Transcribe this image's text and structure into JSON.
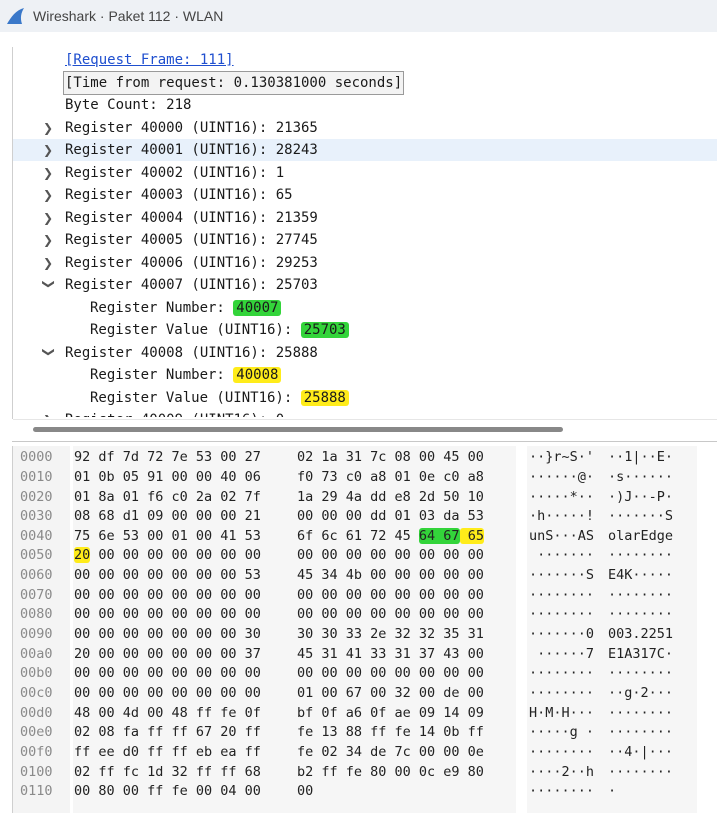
{
  "window": {
    "title": "Wireshark · Paket 112 · WLAN"
  },
  "details": {
    "request_frame": "[Request Frame: 111]",
    "time_from_request": "[Time from request: 0.130381000 seconds]",
    "byte_count": "Byte Count: 218",
    "registers": [
      "Register 40000 (UINT16): 21365",
      "Register 40001 (UINT16): 28243",
      "Register 40002 (UINT16): 1",
      "Register 40003 (UINT16): 65",
      "Register 40004 (UINT16): 21359",
      "Register 40005 (UINT16): 27745",
      "Register 40006 (UINT16): 29253",
      "Register 40007 (UINT16): 25703"
    ],
    "reg40007": {
      "number_label": "Register Number: ",
      "number_value": "40007",
      "value_label": "Register Value (UINT16): ",
      "value_value": "25703"
    },
    "reg40008_header": "Register 40008 (UINT16): 25888",
    "reg40008": {
      "number_label": "Register Number: ",
      "number_value": "40008",
      "value_label": "Register Value (UINT16): ",
      "value_value": "25888"
    },
    "reg40009_partial": "Register 40009 (UINT16): 0"
  },
  "hex": {
    "rows": [
      {
        "off": "0000",
        "b1": "92 df 7d 72 7e 53 00 27",
        "b2": "02 1a 31 7c 08 00 45 00",
        "a1": "··}r~S·'",
        "a2": "··1|··E·"
      },
      {
        "off": "0010",
        "b1": "01 0b 05 91 00 00 40 06",
        "b2": "f0 73 c0 a8 01 0e c0 a8",
        "a1": "······@·",
        "a2": "·s······"
      },
      {
        "off": "0020",
        "b1": "01 8a 01 f6 c0 2a 02 7f",
        "b2": "1a 29 4a dd e8 2d 50 10",
        "a1": "·····*··",
        "a2": "·)J··-P·"
      },
      {
        "off": "0030",
        "b1": "08 68 d1 09 00 00 00 21",
        "b2": "00 00 00 dd 01 03 da 53",
        "a1": "·h·····!",
        "a2": "·······S"
      },
      {
        "off": "0040",
        "b1": "75 6e 53 00 01 00 41 53",
        "b2": "6f 6c 61 72 45 ",
        "b2g": "64 67",
        "b2y": " 65",
        "a1": "unS···AS",
        "a2": "olarEdge"
      },
      {
        "off": "0050",
        "b1y": "20",
        "b1": " 00 00 00 00 00 00 00",
        "b2": "00 00 00 00 00 00 00 00",
        "a1": " ·······",
        "a2": "········"
      },
      {
        "off": "0060",
        "b1": "00 00 00 00 00 00 00 53",
        "b2": "45 34 4b 00 00 00 00 00",
        "a1": "·······S",
        "a2": "E4K·····"
      },
      {
        "off": "0070",
        "b1": "00 00 00 00 00 00 00 00",
        "b2": "00 00 00 00 00 00 00 00",
        "a1": "········",
        "a2": "········"
      },
      {
        "off": "0080",
        "b1": "00 00 00 00 00 00 00 00",
        "b2": "00 00 00 00 00 00 00 00",
        "a1": "········",
        "a2": "········"
      },
      {
        "off": "0090",
        "b1": "00 00 00 00 00 00 00 30",
        "b2": "30 30 33 2e 32 32 35 31",
        "a1": "·······0",
        "a2": "003.2251"
      },
      {
        "off": "00a0",
        "b1": "20 00 00 00 00 00 00 37",
        "b2": "45 31 41 33 31 37 43 00",
        "a1": " ······7",
        "a2": "E1A317C·"
      },
      {
        "off": "00b0",
        "b1": "00 00 00 00 00 00 00 00",
        "b2": "00 00 00 00 00 00 00 00",
        "a1": "········",
        "a2": "········"
      },
      {
        "off": "00c0",
        "b1": "00 00 00 00 00 00 00 00",
        "b2": "01 00 67 00 32 00 de 00",
        "a1": "········",
        "a2": "··g·2···"
      },
      {
        "off": "00d0",
        "b1": "48 00 4d 00 48 ff fe 0f",
        "b2": "bf 0f a6 0f ae 09 14 09",
        "a1": "H·M·H···",
        "a2": "········"
      },
      {
        "off": "00e0",
        "b1": "02 08 fa ff ff 67 20 ff",
        "b2": "fe 13 88 ff fe 14 0b ff",
        "a1": "·····g ·",
        "a2": "········"
      },
      {
        "off": "00f0",
        "b1": "ff ee d0 ff ff eb ea ff",
        "b2": "fe 02 34 de 7c 00 00 0e",
        "a1": "········",
        "a2": "··4·|···"
      },
      {
        "off": "0100",
        "b1": "02 ff fc 1d 32 ff ff 68",
        "b2": "b2 ff fe 80 00 0c e9 80",
        "a1": "····2··h",
        "a2": "········"
      },
      {
        "off": "0110",
        "b1": "00 80 00 ff fe 00 04 00",
        "b2": "00",
        "a1": "········",
        "a2": "·"
      }
    ]
  }
}
